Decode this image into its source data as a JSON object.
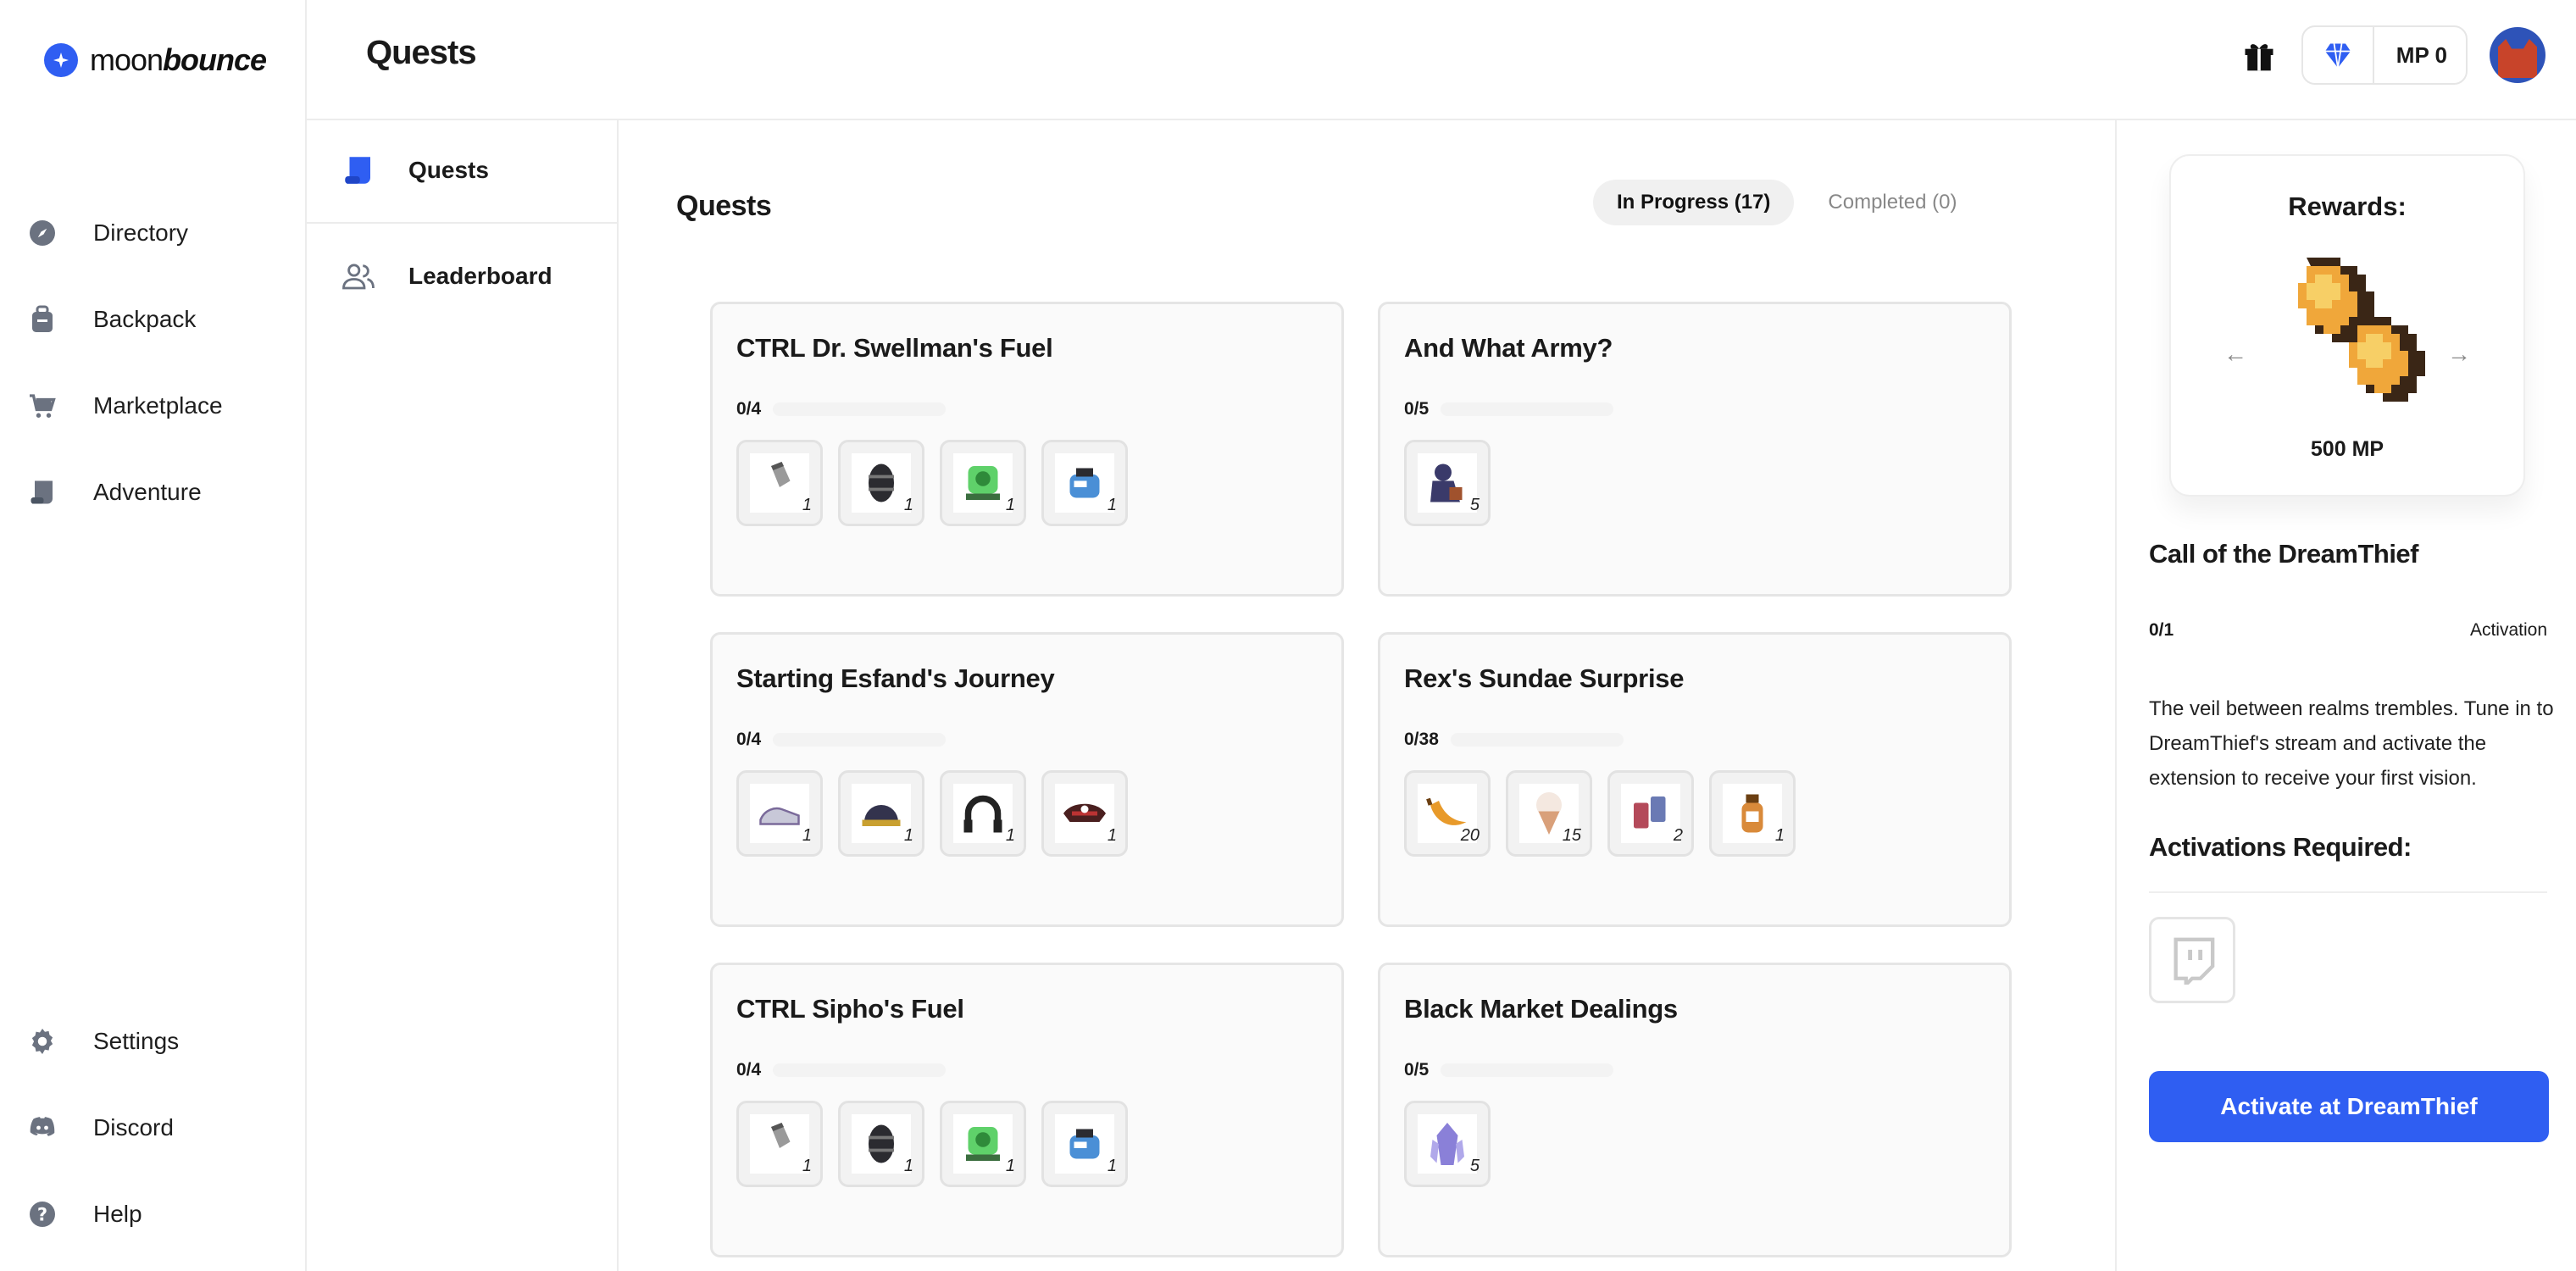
{
  "app": {
    "brand_prefix": "moon",
    "brand_suffix": "bounce"
  },
  "header": {
    "title": "Quests",
    "mp_label": "MP 0"
  },
  "sidebar": {
    "top": [
      {
        "label": "Directory",
        "icon": "compass-icon"
      },
      {
        "label": "Backpack",
        "icon": "backpack-icon"
      },
      {
        "label": "Marketplace",
        "icon": "cart-icon"
      },
      {
        "label": "Adventure",
        "icon": "scroll-icon"
      }
    ],
    "bottom": [
      {
        "label": "Settings",
        "icon": "gear-icon"
      },
      {
        "label": "Discord",
        "icon": "discord-icon"
      },
      {
        "label": "Help",
        "icon": "help-icon"
      }
    ]
  },
  "subnav": {
    "items": [
      {
        "label": "Quests"
      },
      {
        "label": "Leaderboard"
      }
    ]
  },
  "main": {
    "title": "Quests",
    "tabs": [
      {
        "label": "In Progress (17)"
      },
      {
        "label": "Completed (0)"
      }
    ],
    "quests": [
      {
        "title": "CTRL Dr. Swellman's Fuel",
        "progress": "0/4",
        "fraction": 0.0,
        "items": [
          {
            "icon": "salt-shaker-icon",
            "count": "1",
            "color": "#9a9a9a"
          },
          {
            "icon": "barrel-icon",
            "count": "1",
            "color": "#2b2b30"
          },
          {
            "icon": "green-orb-icon",
            "count": "1",
            "color": "#5fd16a"
          },
          {
            "icon": "blue-jar-icon",
            "count": "1",
            "color": "#4a8fd6"
          }
        ]
      },
      {
        "title": "And What Army?",
        "progress": "0/5",
        "fraction": 0.0,
        "items": [
          {
            "icon": "soldier-icon",
            "count": "5",
            "color": "#3a3a6a"
          }
        ]
      },
      {
        "title": "Starting Esfand's Journey",
        "progress": "0/4",
        "fraction": 0.0,
        "items": [
          {
            "icon": "shoe-icon",
            "count": "1",
            "color": "#c8c8d8"
          },
          {
            "icon": "helmet-icon",
            "count": "1",
            "color": "#33334d"
          },
          {
            "icon": "headphones-icon",
            "count": "1",
            "color": "#222"
          },
          {
            "icon": "pirate-hat-icon",
            "count": "1",
            "color": "#4a1f1f"
          }
        ]
      },
      {
        "title": "Rex's Sundae Surprise",
        "progress": "0/38",
        "fraction": 0.0,
        "items": [
          {
            "icon": "banana-icon",
            "count": "20",
            "color": "#e89a2a"
          },
          {
            "icon": "ice-cream-icon",
            "count": "15",
            "color": "#d9a07a"
          },
          {
            "icon": "cups-icon",
            "count": "2",
            "color": "#b44a5a"
          },
          {
            "icon": "bottle-icon",
            "count": "1",
            "color": "#d98a3a"
          }
        ]
      },
      {
        "title": "CTRL Sipho's Fuel",
        "progress": "0/4",
        "fraction": 0.0,
        "items": [
          {
            "icon": "salt-shaker-icon",
            "count": "1",
            "color": "#9a9a9a"
          },
          {
            "icon": "barrel-icon",
            "count": "1",
            "color": "#2b2b30"
          },
          {
            "icon": "green-orb-icon",
            "count": "1",
            "color": "#5fd16a"
          },
          {
            "icon": "blue-jar-icon",
            "count": "1",
            "color": "#4a8fd6"
          }
        ]
      },
      {
        "title": "Black Market Dealings",
        "progress": "0/5",
        "fraction": 0.0,
        "items": [
          {
            "icon": "crystal-icon",
            "count": "5",
            "color": "#8a80d8"
          }
        ]
      }
    ]
  },
  "panel": {
    "rewards_title": "Rewards:",
    "reward_value": "500 MP",
    "quest_title": "Call of the DreamThief",
    "progress": "0/1",
    "progress_label": "Activation",
    "description": "The veil between realms trembles. Tune in to DreamThief's stream and activate the extension to receive your first vision.",
    "activations_title": "Activations Required:",
    "activation_icon": "twitch-icon",
    "button_label": "Activate at DreamThief"
  },
  "colors": {
    "accent": "#2f5ef2"
  }
}
